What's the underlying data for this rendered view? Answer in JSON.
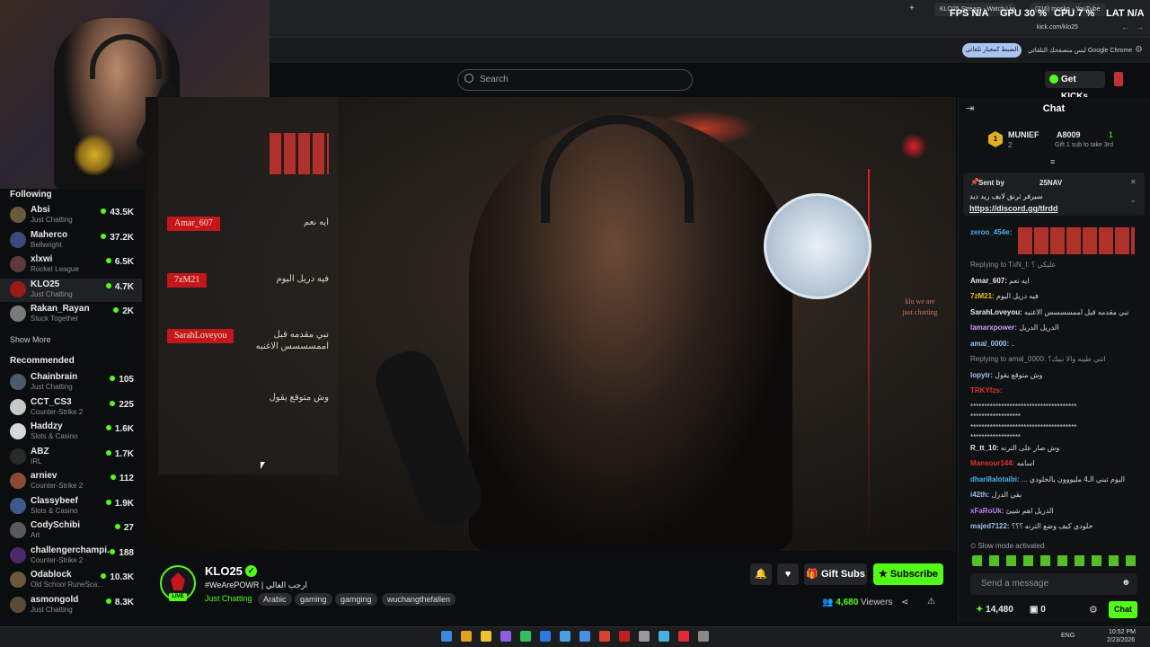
{
  "browser": {
    "tabs": [
      "KLO25 Stream - Watch Live",
      "(216) mosko - YouTube"
    ],
    "url": "kick.com/klo25",
    "info_text": "ليس متصفحك التلقائي Google Chrome",
    "info_button": "الضبط كمعيار تلقائي"
  },
  "hud": {
    "fps_label": "FPS",
    "fps": "N/A",
    "gpu_label": "GPU",
    "gpu": "30 %",
    "cpu_label": "CPU",
    "cpu": "7 %",
    "lat_label": "LAT",
    "lat": "N/A"
  },
  "header": {
    "search_placeholder": "Search",
    "get_kicks": "Get KICKs"
  },
  "sidebar": {
    "following_title": "Following",
    "following": [
      {
        "name": "Absi",
        "category": "Just Chatting",
        "viewers": "43.5K",
        "color": "#6b5a3a"
      },
      {
        "name": "Maherco",
        "category": "Bellwright",
        "viewers": "37.2K",
        "color": "#3a4a7a"
      },
      {
        "name": "xlxwi",
        "category": "Rocket League",
        "viewers": "6.5K",
        "color": "#5a3a3a"
      },
      {
        "name": "KLO25",
        "category": "Just Chatting",
        "viewers": "4.7K",
        "color": "#9a1a1a"
      },
      {
        "name": "Rakan_Rayan",
        "category": "Stuck Together",
        "viewers": "2K",
        "color": "#7a7a7a"
      }
    ],
    "show_more": "Show More",
    "recommended_title": "Recommended",
    "recommended": [
      {
        "name": "Chainbrain",
        "category": "Just Chatting",
        "viewers": "105",
        "color": "#4a5a6a"
      },
      {
        "name": "CCT_CS3",
        "category": "Counter-Strike 2",
        "viewers": "225",
        "color": "#c8c8c8"
      },
      {
        "name": "Haddzy",
        "category": "Slots & Casino",
        "viewers": "1.6K",
        "color": "#d8d8d8"
      },
      {
        "name": "ABZ",
        "category": "IRL",
        "viewers": "1.7K",
        "color": "#2a2a2a"
      },
      {
        "name": "arniev",
        "category": "Counter-Strike 2",
        "viewers": "112",
        "color": "#8a4a3a"
      },
      {
        "name": "Classybeef",
        "category": "Slots & Casino",
        "viewers": "1.9K",
        "color": "#3a5a8a"
      },
      {
        "name": "CodySchibi",
        "category": "Art",
        "viewers": "27",
        "color": "#5a5a5a"
      },
      {
        "name": "challengerchampi...",
        "category": "Counter-Strike 2",
        "viewers": "188",
        "color": "#4a2a6a"
      },
      {
        "name": "Odablock",
        "category": "Old School RuneSca...",
        "viewers": "10.3K",
        "color": "#6a5a3a"
      },
      {
        "name": "asmongold",
        "category": "Just Chatting",
        "viewers": "8.3K",
        "color": "#5a4a3a"
      }
    ]
  },
  "overlay": {
    "messages": [
      {
        "user": "Amar_607",
        "text": "ايه نعم"
      },
      {
        "user": "7zM21",
        "text": "فيه دريل اليوم"
      },
      {
        "user": "SarahLoveyou",
        "text": "نبي مقدمه قبل اممسسسس الاغنيه"
      },
      {
        "user": "",
        "text": "وش متوقع يقول"
      }
    ],
    "side_text": "klo we are just chatting"
  },
  "stream": {
    "channel": "KLO25",
    "title": "#WeArePOWR | ارحب الغالي",
    "category": "Just Chatting",
    "live": "LIVE",
    "tags": [
      "Arabic",
      "gaming",
      "gamging",
      "wuchangthefallen"
    ],
    "gift_subs": "Gift Subs",
    "subscribe": "Subscribe",
    "viewers": "4,680",
    "viewers_label": "Viewers"
  },
  "chat": {
    "title": "Chat",
    "leader1_name": "MUNIEF",
    "leader1_count": "2",
    "leader2_name": "A8009",
    "leader2_count": "1",
    "leader_note": "Gift 1 sub to take 3rd",
    "pinned_by_label": "Sent by",
    "pinned_by": "25NAV",
    "pinned_text": "سيرفر ثرنق لايف ريد ديد",
    "pinned_link": "https://discord.gg/tlrdd",
    "lines": [
      {
        "user": "zeroo_454e:",
        "text": "",
        "color": "#4ab0f0"
      },
      {
        "user": "",
        "text": "Replying to TxN_I: عليكي ؟",
        "color": "#8a9094"
      },
      {
        "user": "Amar_607:",
        "text": "ايه نعم",
        "color": "#e8e8e8"
      },
      {
        "user": "7zM21:",
        "text": "فيه دريل اليوم",
        "color": "#f0c020"
      },
      {
        "user": "SarahLoveyou:",
        "text": "نبي مقدمه قبل اممسسسس الاغنيه",
        "color": "#e8e8e8"
      },
      {
        "user": "lamarxpower:",
        "text": "الدريل الدريل",
        "color": "#c8a0f0"
      },
      {
        "user": "amal_0000:",
        "text": "..",
        "color": "#a0c0f0"
      },
      {
        "user": "",
        "text": "Replying to amal_0000: انتي طيبه والا تبيك؟",
        "color": "#8a9094"
      },
      {
        "user": "lopytr:",
        "text": "وش متوقع يقول",
        "color": "#a0c0f0"
      },
      {
        "user": "TRKYfzs:",
        "text": "",
        "color": "#e03030"
      },
      {
        "user": "",
        "text": "**************************************",
        "color": "#d6d9dc"
      },
      {
        "user": "",
        "text": "******************",
        "color": "#d6d9dc"
      },
      {
        "user": "",
        "text": "**************************************",
        "color": "#d6d9dc"
      },
      {
        "user": "",
        "text": "******************",
        "color": "#d6d9dc"
      },
      {
        "user": "R_tt_10:",
        "text": "وش صار على الترنه",
        "color": "#e8e8e8"
      },
      {
        "user": "Mansour144:",
        "text": "اسامه",
        "color": "#e03030"
      },
      {
        "user": "dhari8alotaibi:",
        "text": "... اليوم تبني الـ4 مليووون يالخلودي",
        "color": "#4ab0f0"
      },
      {
        "user": "i42th:",
        "text": "بقي الدرل",
        "color": "#a0c0f0"
      },
      {
        "user": "xFaRoUk:",
        "text": "الدريل اهم شيئ",
        "color": "#c080f0"
      },
      {
        "user": "majed7122:",
        "text": "خلودي كيف وضع الترنه ؟؟؟",
        "color": "#a0c0f0"
      }
    ],
    "slow_mode": "Slow mode activated",
    "placeholder": "Send a message",
    "kicks": "14,480",
    "gifts": "0",
    "chat_button": "Chat"
  },
  "taskbar": {
    "lang": "ENG",
    "time": "10:52 PM",
    "date": "2/23/2026"
  }
}
